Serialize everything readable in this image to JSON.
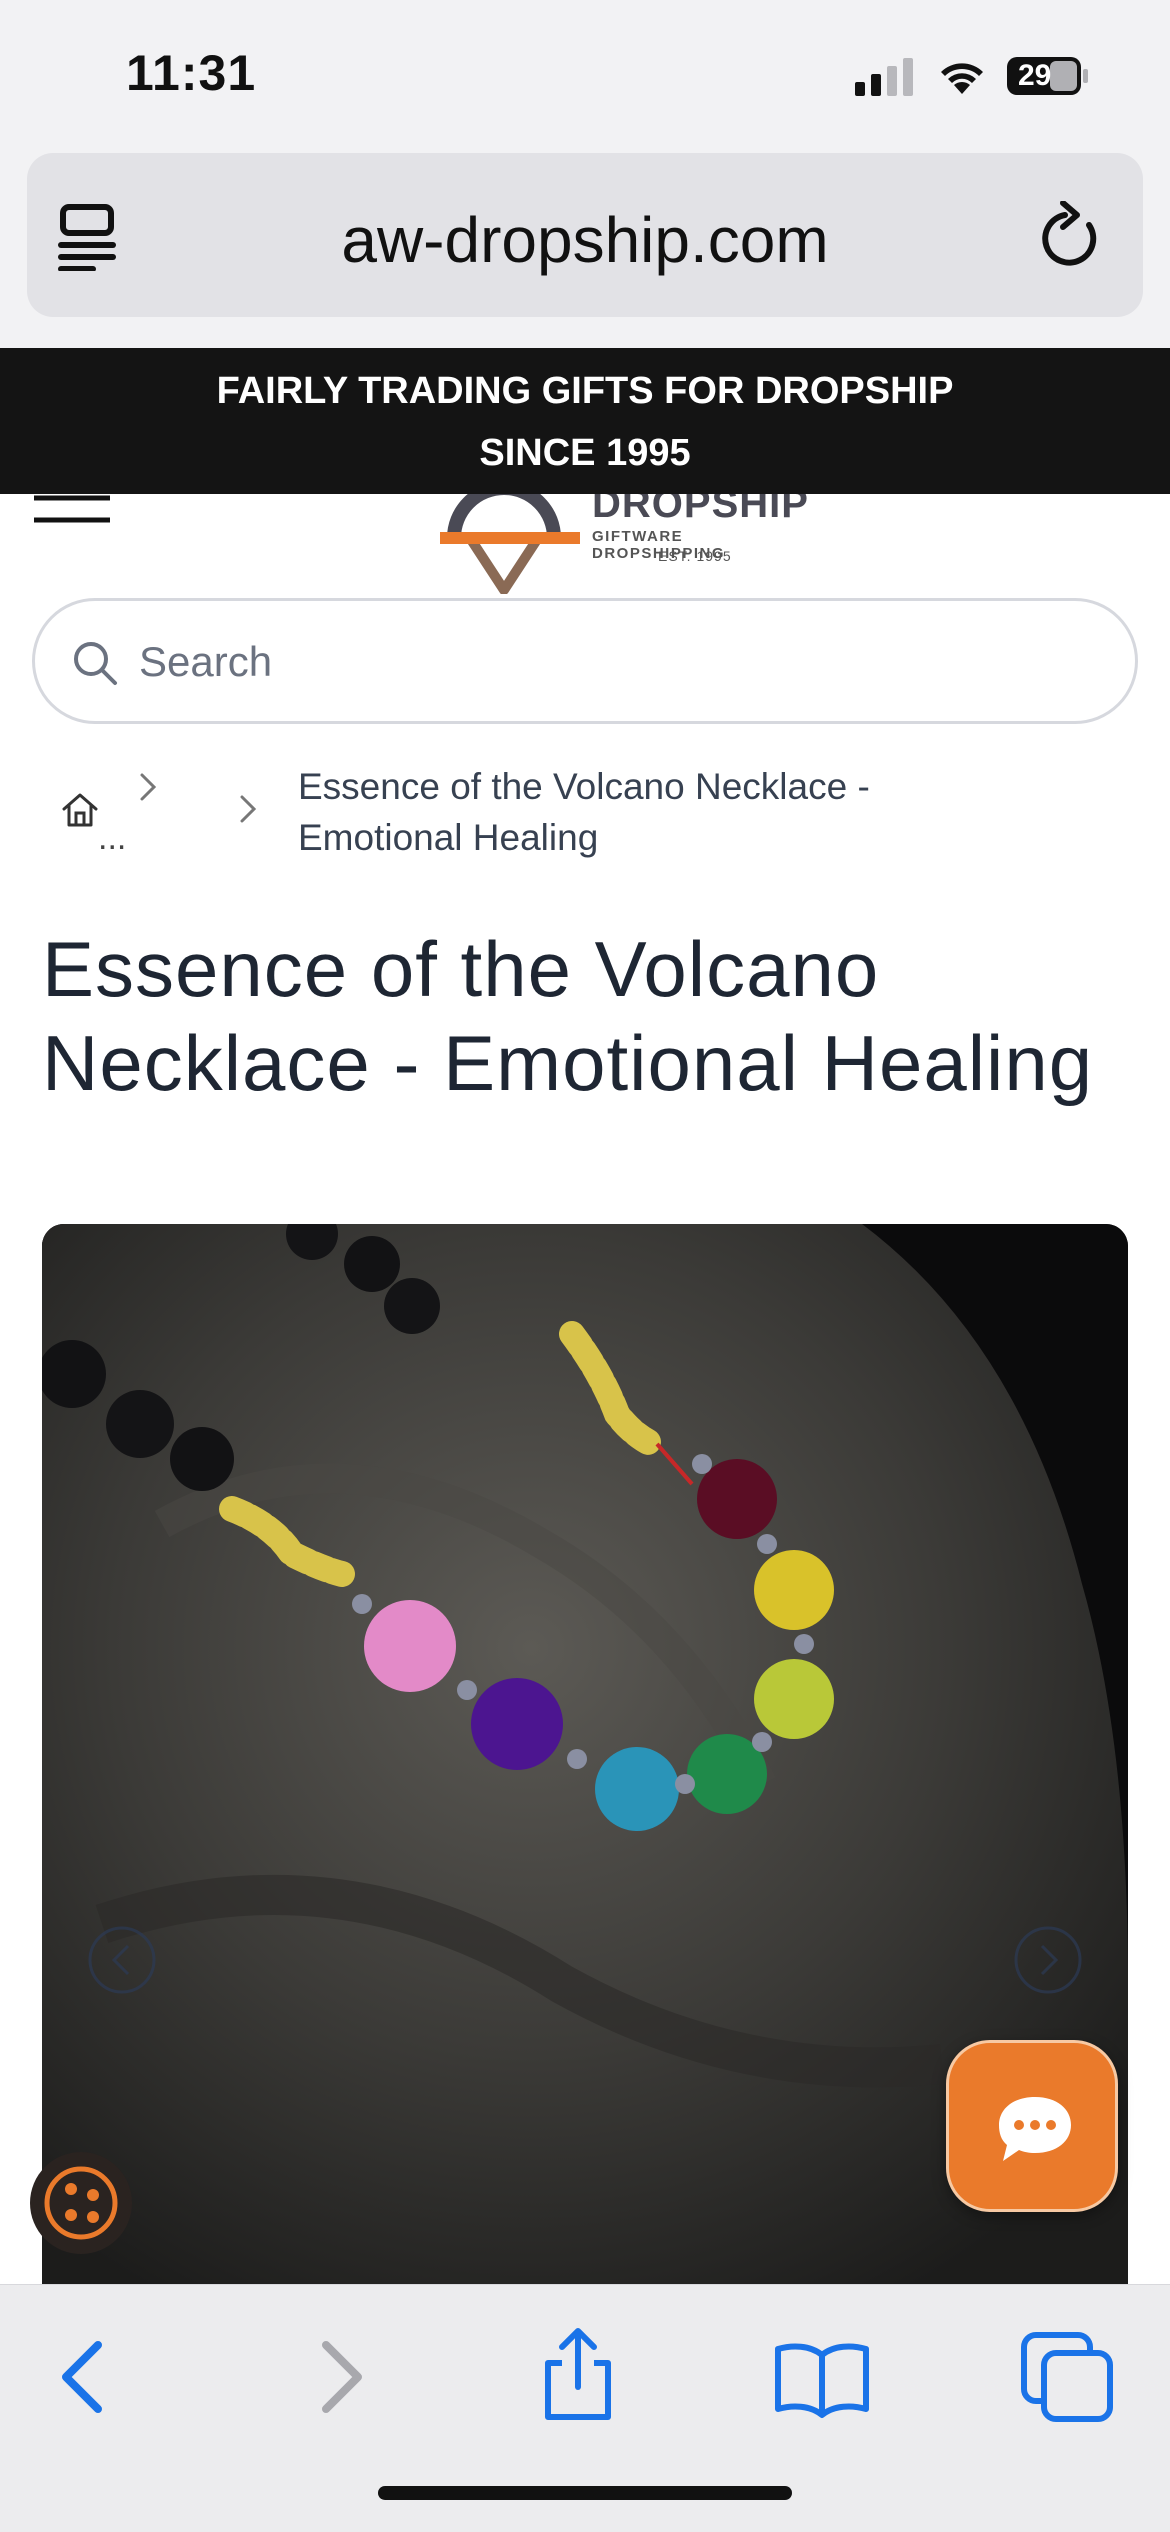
{
  "status_bar": {
    "time": "11:31",
    "battery": "29"
  },
  "browser": {
    "url": "aw-dropship.com"
  },
  "promo": {
    "line1": "FAIRLY TRADING GIFTS FOR DROPSHIP",
    "line2": "SINCE 1995"
  },
  "logo": {
    "word": "DROPSHIP",
    "tagline": "GIFTWARE DROPSHIPPING",
    "est": "EST. 1995"
  },
  "search": {
    "placeholder": "Search"
  },
  "breadcrumb": {
    "ellipsis": "...",
    "current_line1": "Essence of the Volcano Necklace -",
    "current_line2": "Emotional Healing"
  },
  "product": {
    "title": "Essence of the Volcano Necklace - Emotional Healing"
  },
  "colors": {
    "accent": "#ea7a2b",
    "ios_blue": "#1a73e8",
    "banner": "#141414"
  }
}
